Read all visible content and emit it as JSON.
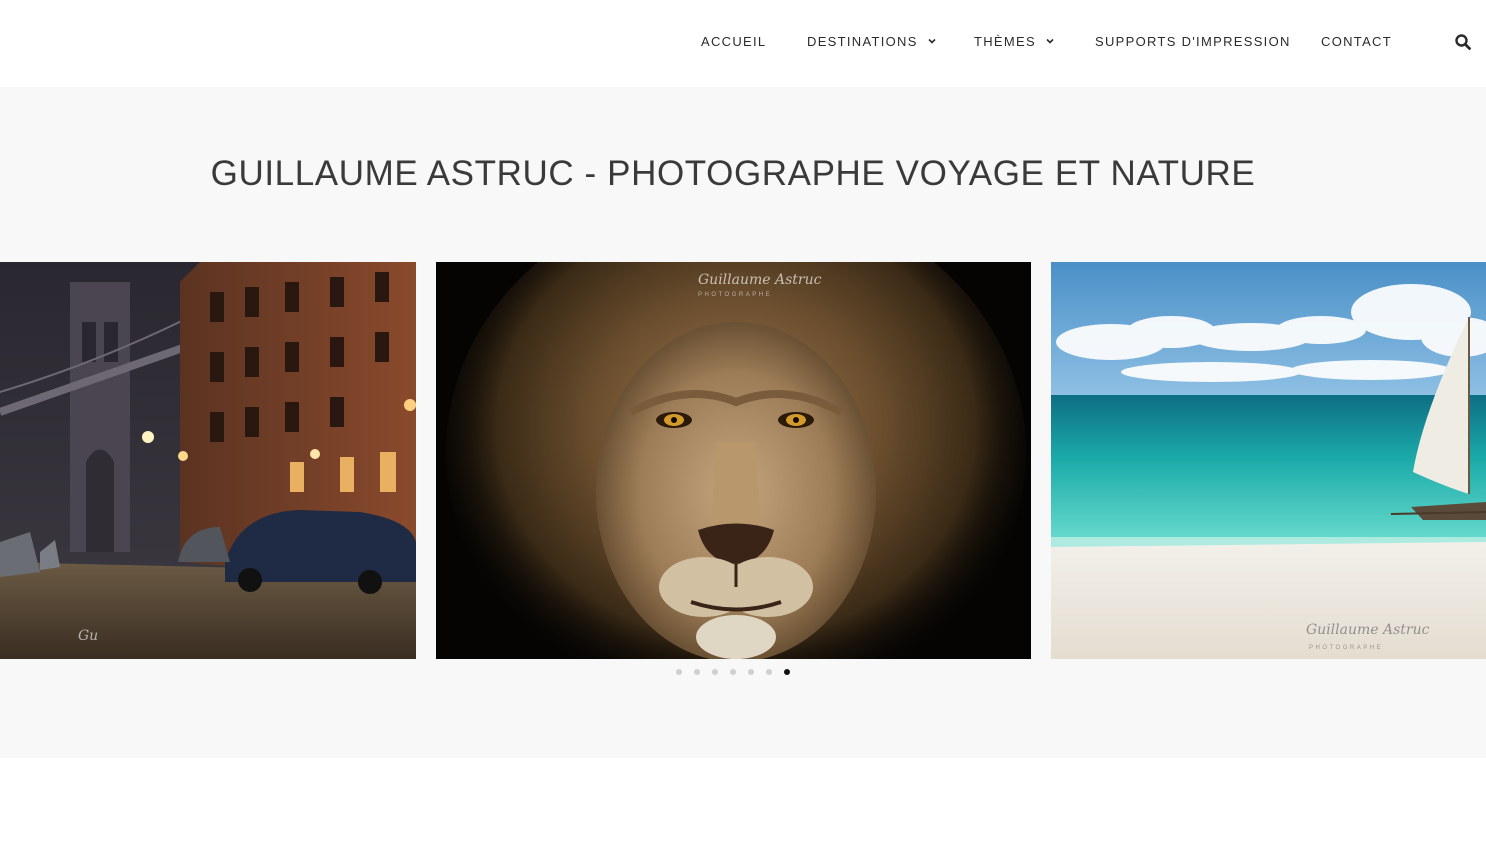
{
  "nav": {
    "items": [
      {
        "label": "ACCUEIL",
        "has_dropdown": false
      },
      {
        "label": "DESTINATIONS",
        "has_dropdown": true
      },
      {
        "label": "THÈMES",
        "has_dropdown": true
      },
      {
        "label": "SUPPORTS D'IMPRESSION",
        "has_dropdown": false
      },
      {
        "label": "CONTACT",
        "has_dropdown": false
      }
    ],
    "search_icon": "search-icon"
  },
  "hero": {
    "title": "GUILLAUME ASTRUC - PHOTOGRAPHE VOYAGE ET NATURE"
  },
  "carousel": {
    "slides": [
      {
        "subject": "night-street-bridge"
      },
      {
        "subject": "lion-portrait"
      },
      {
        "subject": "beach-sailboat"
      }
    ],
    "dot_count": 7,
    "active_dot": 7,
    "watermark": "Guillaume Astruc",
    "watermark_sub": "PHOTOGRAPHE"
  },
  "colors": {
    "band_bg": "#f8f8f8",
    "text": "#2b2b2b",
    "dot_active": "#111111",
    "dot_inactive": "#cfcfcf"
  }
}
